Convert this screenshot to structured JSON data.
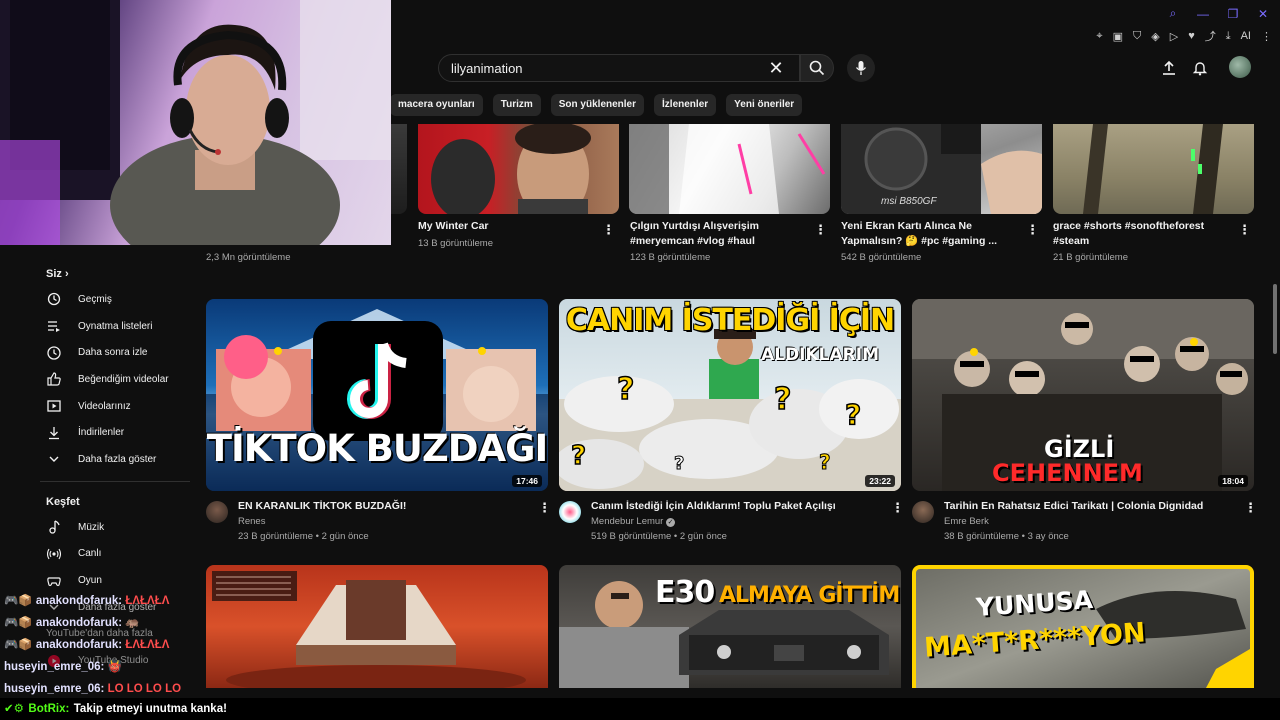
{
  "search": {
    "value": "lilyanimation"
  },
  "browser_ext": {
    "ai_label": "AI"
  },
  "chips": [
    "macera oyunları",
    "Turizm",
    "Son yüklenenler",
    "İzlenenler",
    "Yeni öneriler"
  ],
  "row1": [
    {
      "title_lines": [
        "",
        ""
      ],
      "meta": "2,3 Mn görüntüleme"
    },
    {
      "title_lines": [
        "My Winter Car",
        ""
      ],
      "meta": "13 B görüntüleme"
    },
    {
      "title_lines": [
        "Çılgın Yurtdışı Alışverişim",
        "#meryemcan #vlog #haul"
      ],
      "meta": "123 B görüntüleme"
    },
    {
      "title_lines": [
        "Yeni Ekran Kartı Alınca Ne",
        "Yapmalısın? 🤔 #pc #gaming ..."
      ],
      "meta": "542 B görüntüleme"
    },
    {
      "title_lines": [
        "grace #shorts #sonoftheforest",
        "#steam"
      ],
      "meta": "21 B görüntüleme"
    }
  ],
  "sidebar": {
    "you_label": "Siz",
    "items": [
      {
        "label": "Geçmiş",
        "icon": "history-icon"
      },
      {
        "label": "Oynatma listeleri",
        "icon": "playlist-icon"
      },
      {
        "label": "Daha sonra izle",
        "icon": "clock-icon"
      },
      {
        "label": "Beğendiğim videolar",
        "icon": "thumbs-up-icon"
      },
      {
        "label": "Videolarınız",
        "icon": "video-icon"
      },
      {
        "label": "İndirilenler",
        "icon": "download-icon"
      },
      {
        "label": "Daha fazla göster",
        "icon": "chevron-down-icon"
      }
    ],
    "explore_label": "Keşfet",
    "explore": [
      {
        "label": "Müzik",
        "icon": "music-icon"
      },
      {
        "label": "Canlı",
        "icon": "live-icon"
      },
      {
        "label": "Oyun",
        "icon": "gamepad-icon"
      },
      {
        "label": "Daha fazla göster",
        "icon": "chevron-down-icon"
      },
      {
        "label": "YouTube'dan daha fazla",
        "icon": ""
      },
      {
        "label": "YouTube Studio",
        "icon": "studio-icon"
      }
    ]
  },
  "row2": [
    {
      "thumb_text": "TİKTOK BUZDAĞI",
      "duration": "17:46",
      "title": "EN KARANLIK TİKTOK BUZDAĞI!",
      "channel": "Renes",
      "meta": "23 B görüntüleme • 2 gün önce"
    },
    {
      "thumb_text": "CANIM İSTEDİĞİ İÇİN",
      "thumb_sub": "ALDIKLARIM",
      "duration": "23:22",
      "title": "Canım İstediği İçin Aldıklarım! Toplu Paket Açılışı",
      "channel": "Mendebur Lemur",
      "verified": "✓",
      "meta": "519 B görüntüleme • 2 gün önce"
    },
    {
      "thumb_text": "GİZLİ",
      "thumb_sub": "CEHENNEM",
      "duration": "18:04",
      "title": "Tarihin En Rahatsız Edici Tarikatı | Colonia Dignidad",
      "channel": "Emre Berk",
      "meta": "38 B görüntüleme • 3 ay önce"
    }
  ],
  "row3": [
    {
      "thumb_text": ""
    },
    {
      "thumb_text": "E30",
      "thumb_sub": "ALMAYA GİTTİM"
    },
    {
      "thumb_text": "YUNUSA",
      "thumb_sub": "MA*T*R***YON"
    }
  ],
  "chat": [
    {
      "user": "anakondofaruk:",
      "msg": "ŁΛŁΛŁΛ",
      "color": "#e2e1ff"
    },
    {
      "user": "anakondofaruk:",
      "msg": "🦛",
      "color": "#e2e1ff"
    },
    {
      "user": "anakondofaruk:",
      "msg": "ŁΛŁΛŁΛ",
      "color": "#e2e1ff"
    },
    {
      "user": "huseyin_emre_06:",
      "msg": "👹",
      "color": "#e2e1ff"
    },
    {
      "user": "huseyin_emre_06:",
      "msg": "LO LO LO LO",
      "color": "#e2e1ff"
    }
  ],
  "bot": {
    "user": "BotRix:",
    "msg": "Takip etmeyi unutma kanka!"
  },
  "colors": {
    "accent": "#7a6cff",
    "chat_msg": "#ff4d4d",
    "bot": "#53fc18"
  }
}
